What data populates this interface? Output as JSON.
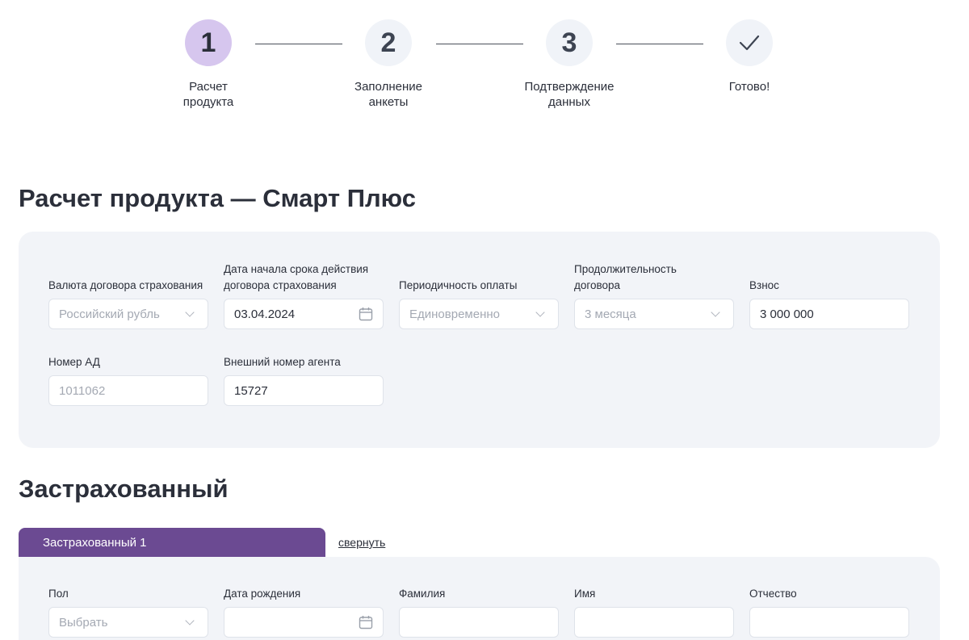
{
  "stepper": {
    "steps": [
      {
        "number": "1",
        "label_line1": "Расчет",
        "label_line2": "продукта"
      },
      {
        "number": "2",
        "label_line1": "Заполнение",
        "label_line2": "анкеты"
      },
      {
        "number": "3",
        "label_line1": "Подтверждение",
        "label_line2": "данных"
      },
      {
        "number": "",
        "label_line1": "Готово!",
        "label_line2": ""
      }
    ],
    "active_step": 1
  },
  "product": {
    "title": "Расчет продукта — Смарт Плюс",
    "fields": {
      "currency": {
        "label": "Валюта договора страхования",
        "value": "Российский рубль"
      },
      "start_date": {
        "label_line1": "Дата начала срока действия",
        "label_line2": "договора страхования",
        "value": "03.04.2024"
      },
      "periodicity": {
        "label": "Периодичность оплаты",
        "value": "Единовременно"
      },
      "duration": {
        "label_line1": "Продолжительность",
        "label_line2": "договора",
        "value": "3 месяца"
      },
      "premium": {
        "label": "Взнос",
        "value": "3 000 000"
      },
      "ad_number": {
        "label": "Номер АД",
        "value": "1011062"
      },
      "agent_number": {
        "label": "Внешний номер агента",
        "value": "15727"
      }
    }
  },
  "insured": {
    "title": "Застрахованный",
    "tab_label": "Застрахованный 1",
    "collapse_label": "свернуть",
    "fields": {
      "gender": {
        "label": "Пол",
        "placeholder": "Выбрать"
      },
      "birth_date": {
        "label": "Дата рождения",
        "value": ""
      },
      "last_name": {
        "label": "Фамилия",
        "value": ""
      },
      "first_name": {
        "label": "Имя",
        "value": ""
      },
      "middle_name": {
        "label": "Отчество",
        "value": ""
      }
    }
  },
  "colors": {
    "accent": "#6b4a92",
    "active_step": "#d6c6ee",
    "panel": "#f2f4f8"
  }
}
